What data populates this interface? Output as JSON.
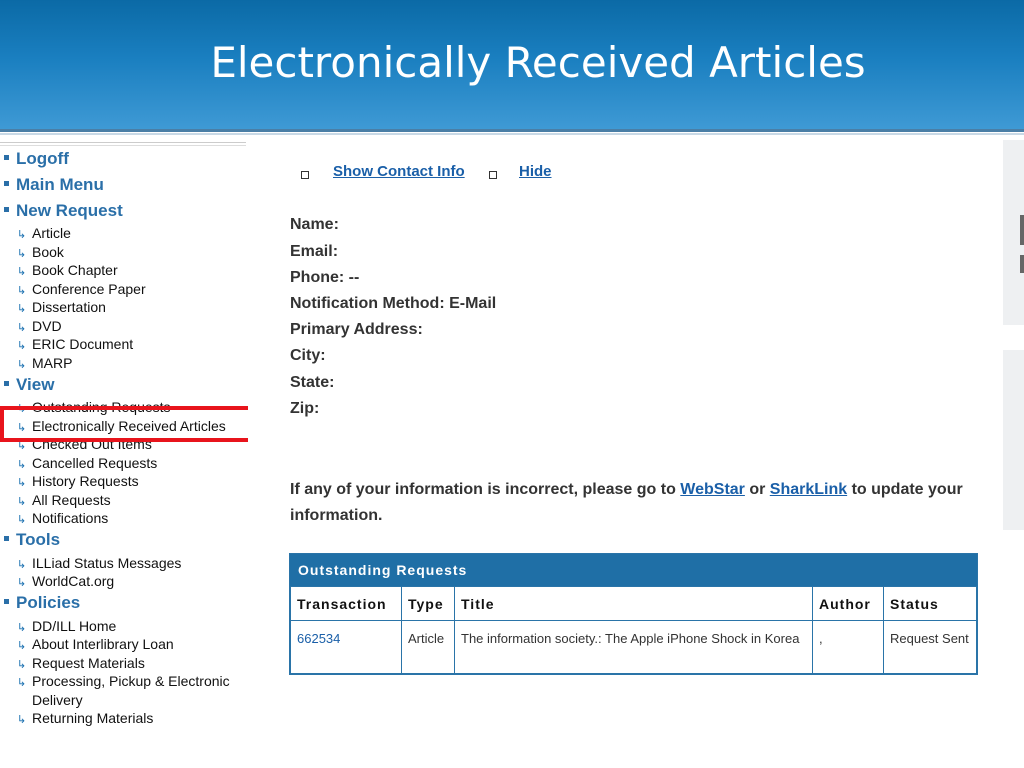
{
  "slide": {
    "title": "Electronically Received Articles"
  },
  "nav": {
    "logoff": "Logoff",
    "main_menu": "Main Menu",
    "new_request": {
      "label": "New Request",
      "items": [
        "Article",
        "Book",
        "Book Chapter",
        "Conference Paper",
        "Dissertation",
        "DVD",
        "ERIC Document",
        "MARP"
      ]
    },
    "view": {
      "label": "View",
      "items": [
        "Outstanding Requests",
        "Electronically Received Articles",
        "Checked Out Items",
        "Cancelled Requests",
        "History Requests",
        "All Requests",
        "Notifications"
      ]
    },
    "tools": {
      "label": "Tools",
      "items": [
        "ILLiad Status Messages",
        "WorldCat.org"
      ]
    },
    "policies": {
      "label": "Policies",
      "items": [
        "DD/ILL Home",
        "About Interlibrary Loan",
        "Request Materials",
        "Processing, Pickup & Electronic",
        "Delivery",
        "Returning Materials"
      ]
    }
  },
  "contact": {
    "show": "Show Contact Info",
    "hide": "Hide"
  },
  "fields": {
    "name": "Name:",
    "email": "Email:",
    "phone": "Phone: --",
    "notification": "Notification Method: E-Mail",
    "address": "Primary Address:",
    "city": "City:",
    "state": "State:",
    "zip": "Zip:"
  },
  "info": {
    "pre": "If any of your information is incorrect, please go to ",
    "link1": "WebStar",
    "mid": " or ",
    "link2": "SharkLink",
    "post": " to update your information."
  },
  "table": {
    "caption": "Outstanding Requests",
    "headers": [
      "Transaction",
      "Type",
      "Title",
      "Author",
      "Status"
    ],
    "row": {
      "transaction": "662534",
      "type": "Article",
      "title": "The information society.: The Apple iPhone Shock in Korea",
      "author": ",",
      "status": "Request Sent"
    }
  }
}
